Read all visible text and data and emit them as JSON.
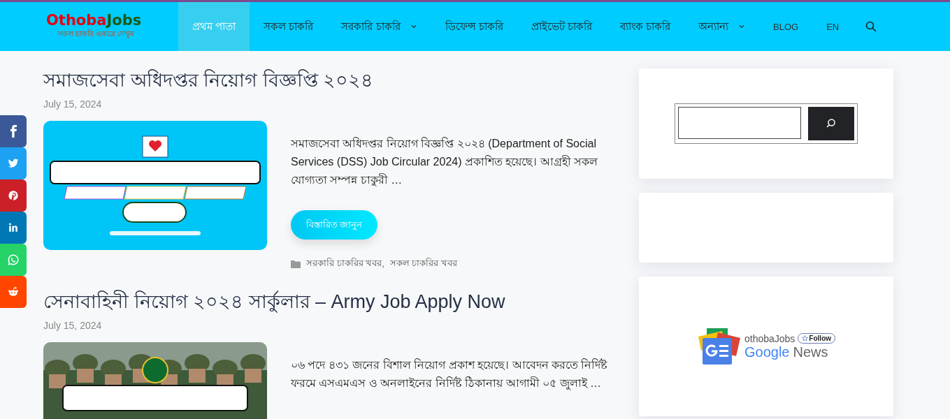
{
  "header": {
    "logo": {
      "part_1": "Othoba",
      "part_2": "Jobs",
      "tagline": "সকল চাকরি একত্রে দেখুন"
    },
    "nav": [
      {
        "label": "প্রথম পাতা",
        "selected": true,
        "dropdown": false
      },
      {
        "label": "সকল চাকরি",
        "selected": false,
        "dropdown": false
      },
      {
        "label": "সরকারি চাকরি",
        "selected": false,
        "dropdown": true
      },
      {
        "label": "ডিফেন্স চাকরি",
        "selected": false,
        "dropdown": false
      },
      {
        "label": "প্রাইভেট চাকরি",
        "selected": false,
        "dropdown": false
      },
      {
        "label": "ব্যাংক চাকরি",
        "selected": false,
        "dropdown": false
      },
      {
        "label": "অন্যান্য",
        "selected": false,
        "dropdown": true
      },
      {
        "label": "BLOG",
        "selected": false,
        "dropdown": false
      },
      {
        "label": "EN",
        "selected": false,
        "dropdown": false
      }
    ]
  },
  "share_buttons": [
    {
      "kind": "facebook"
    },
    {
      "kind": "twitter"
    },
    {
      "kind": "pinterest"
    },
    {
      "kind": "linkedin"
    },
    {
      "kind": "whatsapp"
    },
    {
      "kind": "reddit"
    }
  ],
  "posts": [
    {
      "title": "সমাজসেবা অধিদপ্তর নিয়োগ বিজ্ঞপ্তি ২০২৪",
      "date": "July 15, 2024",
      "excerpt": "সমাজসেবা অধিদপ্তর নিয়োগ বিজ্ঞপ্তি ২০২৪ (Department of Social Services  (DSS) Job Circular 2024) প্রকাশিত হয়েছে। আগ্রহী সকল যোগ্যতা সম্পন্ন চাকুরী …",
      "button": "বিস্তারিত জানুন",
      "categories": [
        "সরকারি চাকরির খবর",
        "সকল চাকরির খবর"
      ],
      "separator": ","
    },
    {
      "title": "সেনাবাহিনী নিয়োগ ২০২৪ সার্কুলার – Army Job Apply Now",
      "date": "July 15, 2024",
      "excerpt": "০৬ পদে ৪৩১ জনের বিশাল নিয়োগ প্রকাশ হয়েছে। আবেদন করতে নির্দিষ্ট ফরমে এসএমএস ও অনলাইনের নির্দিষ্ট ঠিকানায় আগামী ০৫ জুলাই …"
    }
  ],
  "sidebar": {
    "google_news": {
      "site": "othobaJobs",
      "follow": "Follow",
      "brand_1": "Google",
      "brand_2": "News"
    }
  }
}
